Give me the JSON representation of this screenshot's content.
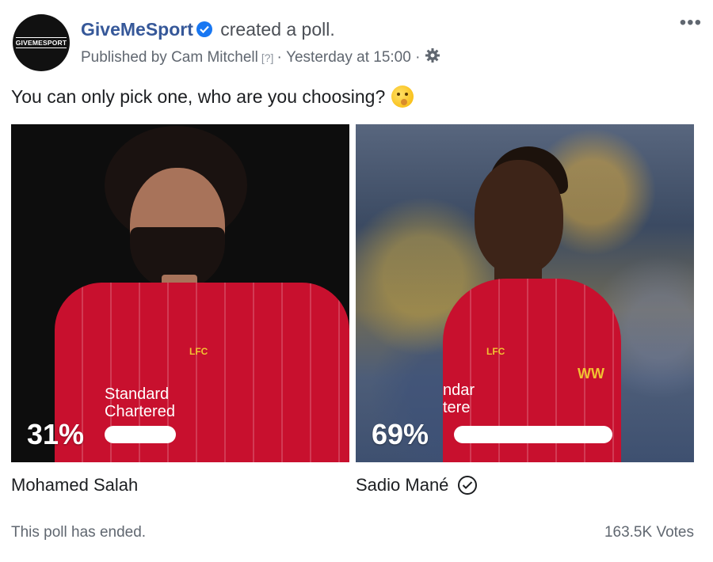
{
  "post": {
    "avatar_text": "GIVEMESPORT",
    "page_name": "GiveMeSport",
    "action": "created a poll.",
    "published_by": "Published by Cam Mitchell",
    "help_marker": "[?]",
    "separator": "·",
    "time": "Yesterday at 15:00",
    "more_label": "•••",
    "question": "You can only pick one, who are you choosing?"
  },
  "poll": {
    "options": [
      {
        "name": "Mohamed Salah",
        "percent_label": "31%",
        "percent": 31,
        "selected": false,
        "sponsor_line1": "Standard",
        "sponsor_line2": "Chartered",
        "crest": "LFC"
      },
      {
        "name": "Sadio Mané",
        "percent_label": "69%",
        "percent": 69,
        "selected": true,
        "sponsor_line1": "ndar",
        "sponsor_line2": "tere",
        "crest": "LFC",
        "sleeve": "WW"
      }
    ],
    "status": "This poll has ended.",
    "votes": "163.5K Votes"
  },
  "colors": {
    "page_name": "#365899",
    "verified": "#1877f2",
    "kit": "#c8102e",
    "muted_text": "#606770"
  },
  "icons": {
    "verified": "verified-badge-icon",
    "gear": "gear-icon",
    "more": "more-options-icon",
    "emoji": "thinking-emoji-icon",
    "check": "check-circle-icon"
  }
}
